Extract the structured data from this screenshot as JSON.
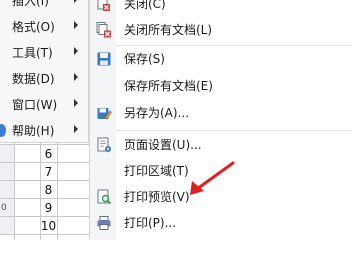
{
  "parent_menu": {
    "items": [
      {
        "label": "插入(I)",
        "has_submenu": true
      },
      {
        "label": "格式(O)",
        "has_submenu": true
      },
      {
        "label": "工具(T)",
        "has_submenu": true
      },
      {
        "label": "数据(D)",
        "has_submenu": true
      },
      {
        "label": "窗口(W)",
        "has_submenu": true
      },
      {
        "label": "帮助(H)",
        "has_submenu": true,
        "active": true
      }
    ]
  },
  "file_menu": {
    "items": [
      {
        "label": "关闭(C)",
        "icon": "close-document-icon"
      },
      {
        "label": "关闭所有文档(L)",
        "icon": "close-all-documents-icon"
      },
      {
        "label": "保存(S)",
        "icon": "save-icon"
      },
      {
        "label": "保存所有文档(E)",
        "icon": ""
      },
      {
        "label": "另存为(A)...",
        "icon": "save-as-icon"
      },
      {
        "label": "页面设置(U)...",
        "icon": "page-setup-icon"
      },
      {
        "label": "打印区域(T)",
        "icon": ""
      },
      {
        "label": "打印预览(V)",
        "icon": "print-preview-icon"
      },
      {
        "label": "打印(P)...",
        "icon": "print-icon"
      }
    ]
  },
  "sheet": {
    "rows": [
      {
        "row_label": "",
        "value": "6"
      },
      {
        "row_label": "",
        "value": "7"
      },
      {
        "row_label": "",
        "value": "8"
      },
      {
        "row_label": "0",
        "value": "9"
      },
      {
        "row_label": "",
        "value": "10"
      }
    ]
  },
  "colors": {
    "annotation_arrow": "#e02020",
    "menu_bg": "#f7f8fa",
    "active_highlight": "#d9e6f5",
    "save_icon_blue": "#3a78c7"
  }
}
